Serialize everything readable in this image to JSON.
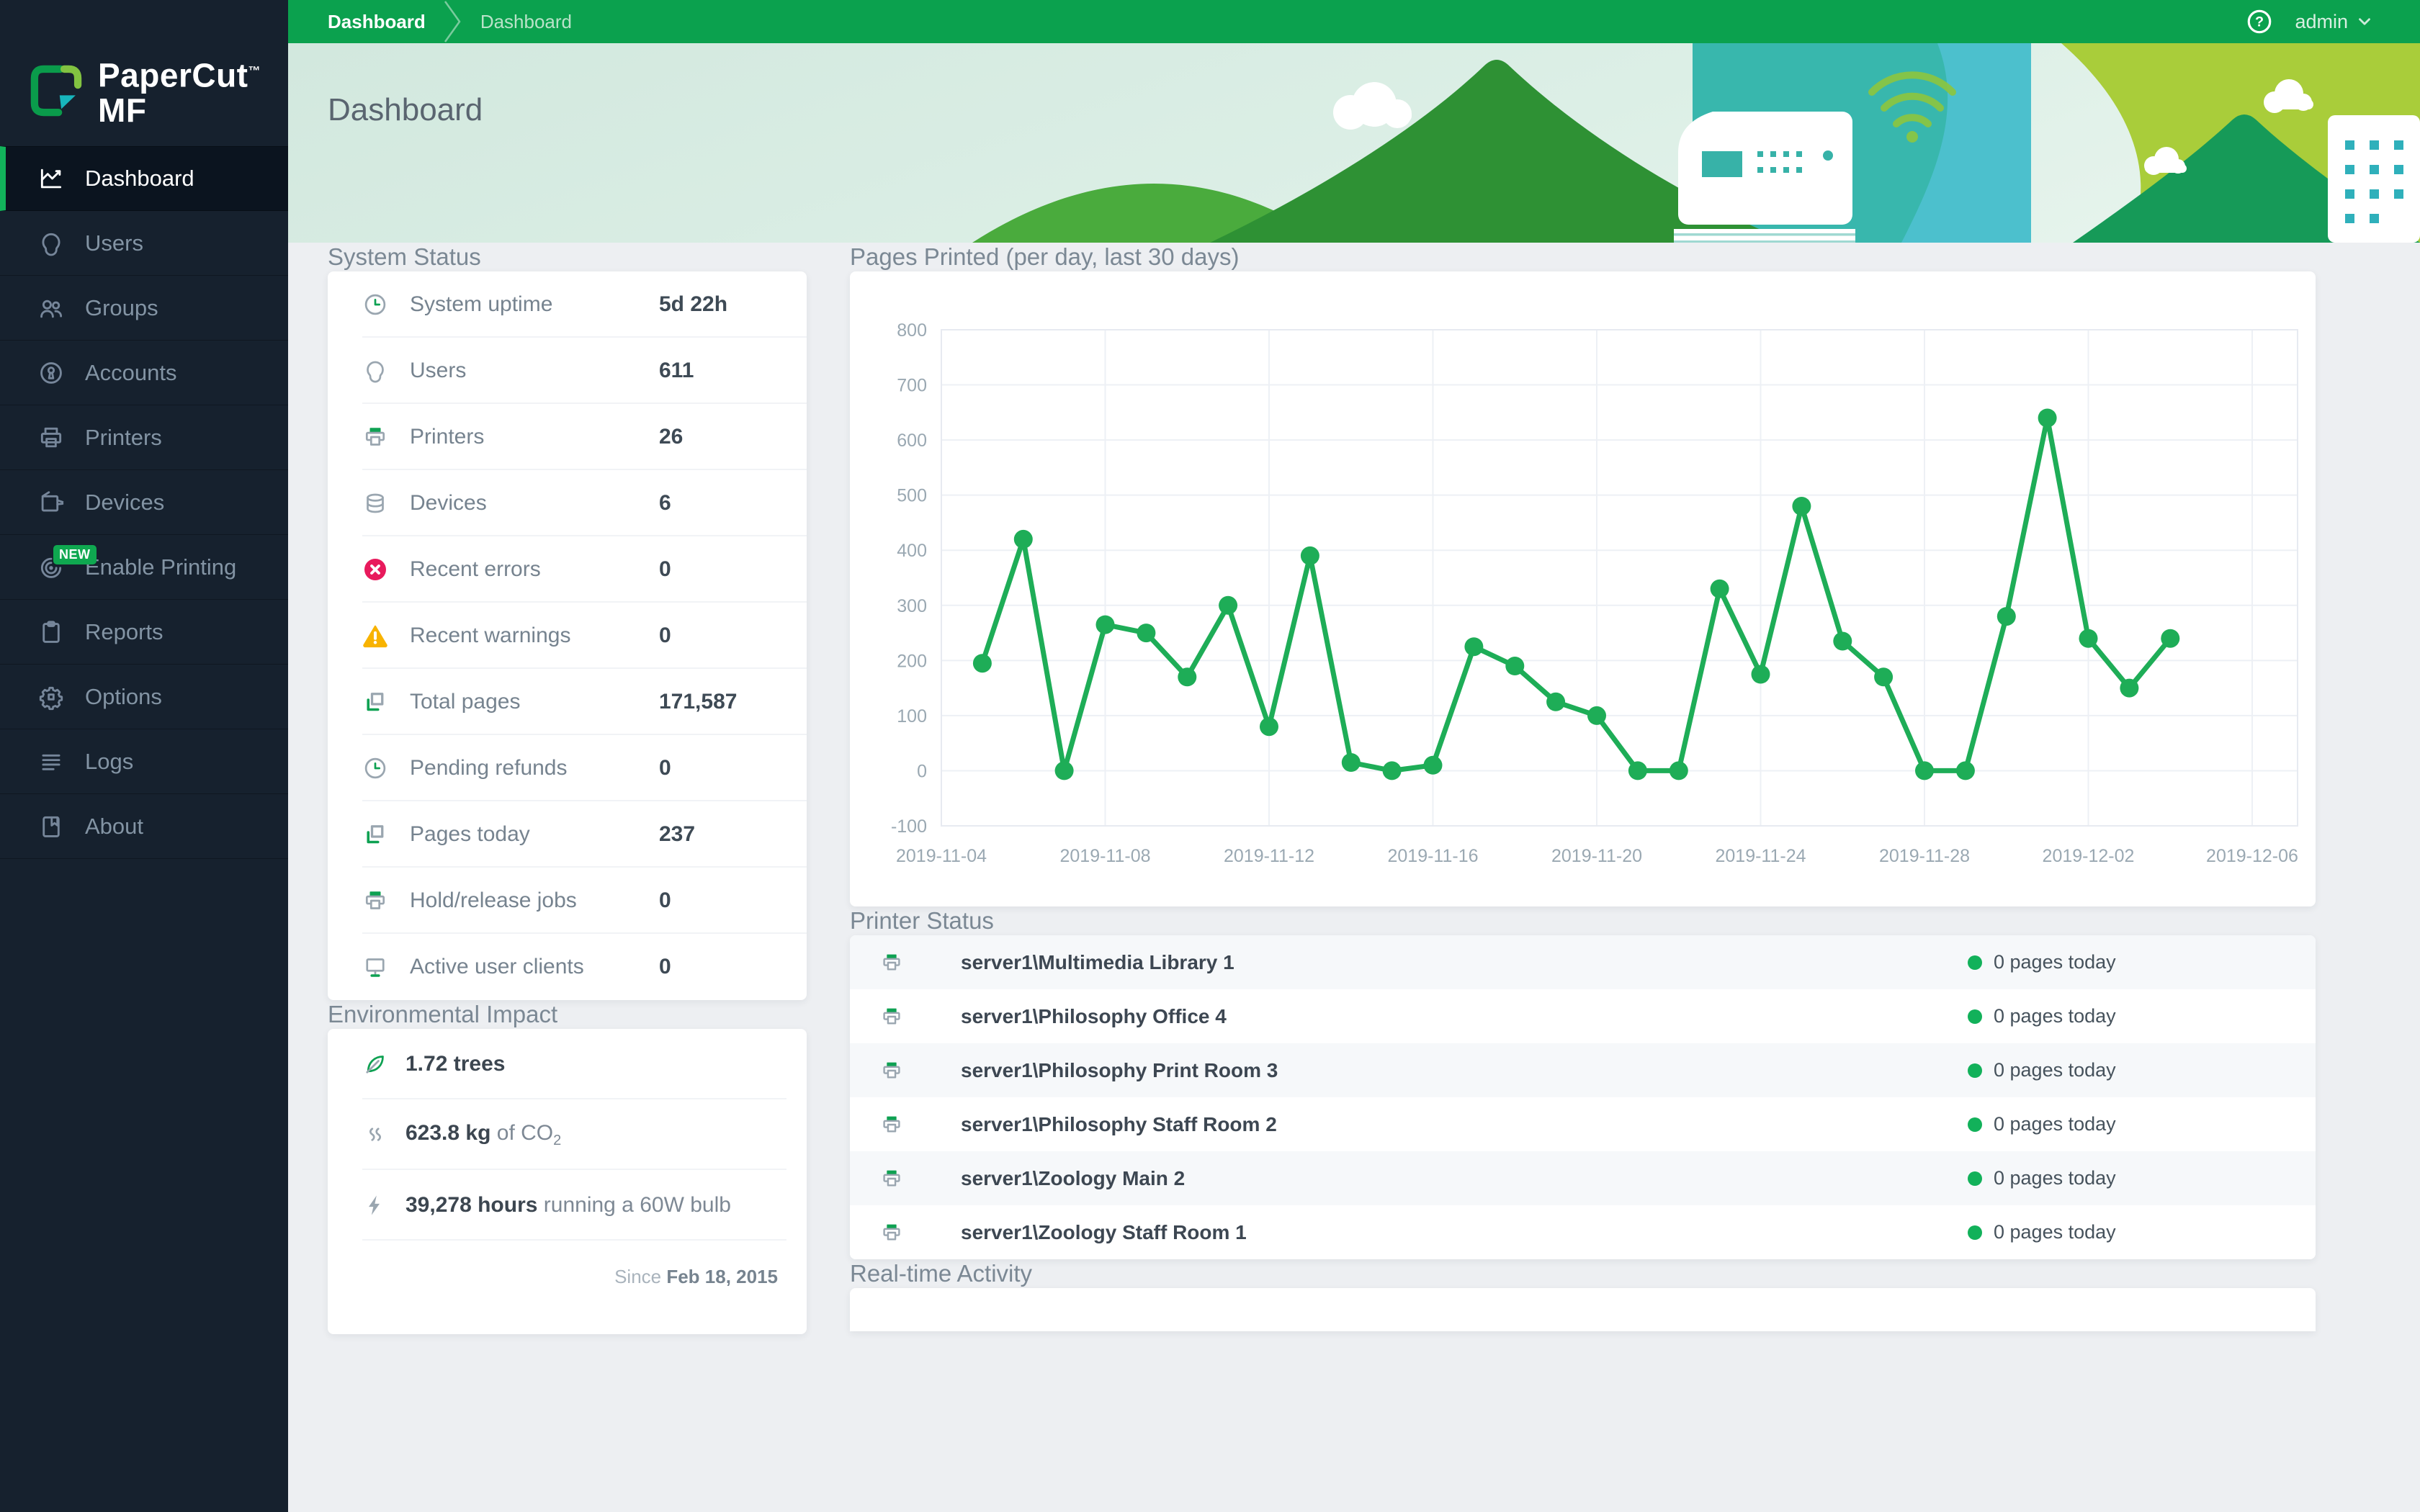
{
  "topbar": {
    "breadcrumb": [
      "Dashboard",
      "Dashboard"
    ],
    "user": "admin"
  },
  "sidebar": {
    "logo_line1": "PaperCut",
    "logo_tm": "™",
    "logo_line2": "MF",
    "items": [
      {
        "label": "Dashboard",
        "icon": "dashboard-chart",
        "active": true
      },
      {
        "label": "Users",
        "icon": "user-head"
      },
      {
        "label": "Groups",
        "icon": "groups"
      },
      {
        "label": "Accounts",
        "icon": "account-key"
      },
      {
        "label": "Printers",
        "icon": "printer"
      },
      {
        "label": "Devices",
        "icon": "device-mfd"
      },
      {
        "label": "Enable Printing",
        "icon": "enable-target",
        "badge": "NEW"
      },
      {
        "label": "Reports",
        "icon": "clipboard"
      },
      {
        "label": "Options",
        "icon": "gear"
      },
      {
        "label": "Logs",
        "icon": "log-lines"
      },
      {
        "label": "About",
        "icon": "book"
      }
    ]
  },
  "banner": {
    "title": "Dashboard"
  },
  "system_status": {
    "heading": "System Status",
    "rows": [
      {
        "icon": "clock",
        "label": "System uptime",
        "value": "5d 22h"
      },
      {
        "icon": "user-head",
        "label": "Users",
        "value": "611"
      },
      {
        "icon": "printer-green",
        "label": "Printers",
        "value": "26"
      },
      {
        "icon": "database",
        "label": "Devices",
        "value": "6"
      },
      {
        "icon": "error-circle",
        "label": "Recent errors",
        "value": "0"
      },
      {
        "icon": "warning-triangle",
        "label": "Recent warnings",
        "value": "0"
      },
      {
        "icon": "pages",
        "label": "Total pages",
        "value": "171,587"
      },
      {
        "icon": "clock",
        "label": "Pending refunds",
        "value": "0"
      },
      {
        "icon": "pages",
        "label": "Pages today",
        "value": "237"
      },
      {
        "icon": "printer-green",
        "label": "Hold/release jobs",
        "value": "0"
      },
      {
        "icon": "monitor",
        "label": "Active user clients",
        "value": "0"
      }
    ]
  },
  "environmental": {
    "heading": "Environmental Impact",
    "rows": [
      {
        "icon": "leaf",
        "bold": "1.72 trees",
        "rest": "",
        "sub": ""
      },
      {
        "icon": "co2-steam",
        "bold": "623.8 kg",
        "rest": " of CO",
        "sub": "2"
      },
      {
        "icon": "bolt",
        "bold": "39,278 hours",
        "rest": " running a 60W bulb",
        "sub": ""
      }
    ],
    "since_label": "Since ",
    "since_date": "Feb 18, 2015"
  },
  "chart": {
    "heading": "Pages Printed (per day, last 30 days)"
  },
  "chart_data": {
    "type": "line",
    "title": "Pages Printed (per day, last 30 days)",
    "series_name": "Pages printed per day",
    "xlabel": "",
    "ylabel": "",
    "ylim": [
      -100,
      800
    ],
    "y_ticks": [
      800,
      700,
      600,
      500,
      400,
      300,
      200,
      100,
      0,
      -100
    ],
    "x_ticks": [
      "2019-11-04",
      "2019-11-08",
      "2019-11-12",
      "2019-11-16",
      "2019-11-20",
      "2019-11-24",
      "2019-11-28",
      "2019-12-02",
      "2019-12-06"
    ],
    "x_tick_span_days": 4,
    "dates": [
      "2019-11-05",
      "2019-11-06",
      "2019-11-07",
      "2019-11-08",
      "2019-11-09",
      "2019-11-10",
      "2019-11-11",
      "2019-11-12",
      "2019-11-13",
      "2019-11-14",
      "2019-11-15",
      "2019-11-16",
      "2019-11-17",
      "2019-11-18",
      "2019-11-19",
      "2019-11-20",
      "2019-11-21",
      "2019-11-22",
      "2019-11-23",
      "2019-11-24",
      "2019-11-25",
      "2019-11-26",
      "2019-11-27",
      "2019-11-28",
      "2019-11-29",
      "2019-11-30",
      "2019-12-01",
      "2019-12-02",
      "2019-12-03",
      "2019-12-04"
    ],
    "values": [
      195,
      420,
      0,
      265,
      250,
      170,
      300,
      80,
      390,
      15,
      0,
      10,
      225,
      190,
      125,
      100,
      0,
      0,
      330,
      175,
      480,
      235,
      170,
      0,
      0,
      280,
      640,
      240,
      150,
      240
    ],
    "line_color": "#1ead57",
    "marker": "circle",
    "grid": true,
    "legend": false
  },
  "printer_status": {
    "heading": "Printer Status",
    "rows": [
      {
        "name": "server1\\Multimedia Library 1",
        "status": "0 pages today"
      },
      {
        "name": "server1\\Philosophy Office 4",
        "status": "0 pages today"
      },
      {
        "name": "server1\\Philosophy Print Room 3",
        "status": "0 pages today"
      },
      {
        "name": "server1\\Philosophy Staff Room 2",
        "status": "0 pages today"
      },
      {
        "name": "server1\\Zoology Main 2",
        "status": "0 pages today"
      },
      {
        "name": "server1\\Zoology Staff Room 1",
        "status": "0 pages today"
      }
    ]
  },
  "realtime": {
    "heading": "Real-time Activity"
  },
  "colors": {
    "topbar_green": "#0ba14e",
    "accent_green": "#0fa850",
    "chart_line": "#1ead57",
    "status_ok_dot": "#12b15a",
    "error_red": "#e81a5c",
    "warning_yellow": "#f8b301",
    "sidebar_bg": "#16212e",
    "banner_teal": "#38b7ad",
    "banner_lime": "#a9cd3a"
  }
}
